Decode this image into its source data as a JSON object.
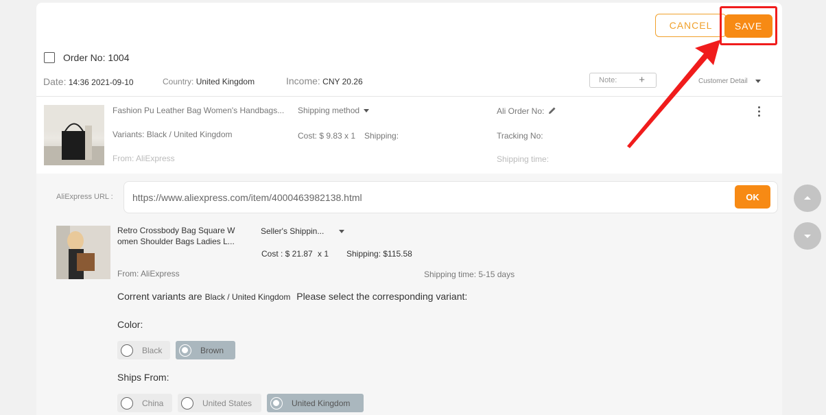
{
  "header": {
    "cancel_label": "CANCEL",
    "save_label": "SAVE"
  },
  "order": {
    "title": "Order No: 1004",
    "date_label": "Date:",
    "date_value": "14:36 2021-09-10",
    "country_label": "Country:",
    "country_value": "United Kingdom",
    "income_label": "Income:",
    "income_value": "CNY 20.26",
    "note_placeholder": "Note:",
    "note_add": "+",
    "customer_detail": "Customer Detail"
  },
  "product": {
    "name": "Fashion Pu Leather Bag Women's Handbags...",
    "variants": "Variants: Black / United Kingdom",
    "from": "From: AliExpress",
    "shipping_method": "Shipping method",
    "cost": "Cost: $ 9.83 x 1",
    "shipping": "Shipping:",
    "ali_order_no": "Ali Order No:",
    "tracking_no": "Tracking No:",
    "shipping_time": "Shipping time:"
  },
  "aliexpress": {
    "url_label": "AliExpress URL :",
    "url_value": "https://www.aliexpress.com/item/4000463982138.html",
    "ok_label": "OK",
    "item_title_line1": "Retro Crossbody Bag Square W",
    "item_title_line2": "omen Shoulder Bags Ladies L...",
    "seller_shipping": "Seller's Shippin...",
    "cost": "Cost : $ 21.87",
    "qty": "x 1",
    "shipping": "Shipping: $115.58",
    "from": "From: AliExpress",
    "shipping_time": "Shipping time: 5-15 days"
  },
  "variant_select": {
    "prefix": "Corrent variants are",
    "current": "Black / United Kingdom",
    "suffix": "Please select the corresponding variant:",
    "color_label": "Color:",
    "colors": [
      {
        "label": "Black",
        "selected": false
      },
      {
        "label": "Brown",
        "selected": true
      }
    ],
    "ships_from_label": "Ships From:",
    "ships_from": [
      {
        "label": "China",
        "selected": false
      },
      {
        "label": "United States",
        "selected": false
      },
      {
        "label": "United Kingdom",
        "selected": true
      }
    ]
  },
  "colors": {
    "accent": "#f78a14",
    "annotation": "#f01c1c",
    "selected_chip": "#aab7be"
  },
  "icons": [
    "checkbox-icon",
    "pencil-icon",
    "kebab-menu-icon",
    "caret-down-icon",
    "radio-icon",
    "scroll-up-icon",
    "scroll-down-icon",
    "annotation-arrow-icon"
  ]
}
